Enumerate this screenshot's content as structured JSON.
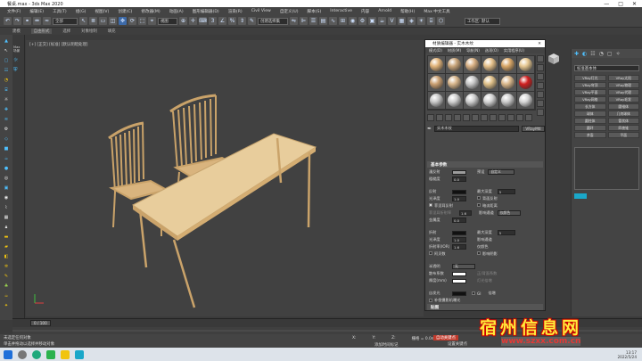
{
  "window": {
    "title": "餐桌.max - 3ds Max 2020",
    "minimize": "—",
    "maximize": "□",
    "close": "✕"
  },
  "menus": [
    "文件(F)",
    "编辑(E)",
    "工具(T)",
    "组(G)",
    "视图(V)",
    "创建(C)",
    "修改器(M)",
    "动画(A)",
    "图形编辑器(D)",
    "渲染(R)",
    "Civil View",
    "自定义(U)",
    "脚本(S)",
    "Interactive",
    "内容",
    "Arnold",
    "帮助(H)",
    "Max 中文工具"
  ],
  "toolbar": {
    "filter": "全部",
    "view": "视图",
    "selection_set": "创建选择集",
    "workspace": "工作区: 默认"
  },
  "ribbon": [
    "建模",
    "自由形式",
    "选择",
    "对象绘制",
    "填充"
  ],
  "ribbon_active": 1,
  "viewport_label": "[+] [正交] [标准] [默认明暗处理]",
  "scene_label": "Max\n场景",
  "right_panel": {
    "dropdown": "标准基本体",
    "buttons": [
      "VRay灯光",
      "VRay太阳",
      "VRay穹顶",
      "VRay物理",
      "VRay平面",
      "VRay代理",
      "VRay网格",
      "VRay毛发",
      "长方体",
      "圆锥体",
      "球体",
      "几何球体",
      "圆柱体",
      "管状体",
      "圆环",
      "四棱锥",
      "茶壶",
      "平面"
    ]
  },
  "mat_editor": {
    "title": "材质编辑器 - 实木木纹",
    "menus": [
      "模式(D)",
      "材质(M)",
      "导航(N)",
      "选项(O)",
      "实用程序(U)"
    ],
    "material_name": "实木木纹",
    "material_type": "VRayMtl",
    "sphere_colors": [
      "#e2b47a",
      "#c9a57a",
      "#d8b084",
      "#e5c08a",
      "#d9a768",
      "#e6c791",
      "#cba072",
      "#d8b68c",
      "#c8c8c8",
      "#e0c18a",
      "#dab88c",
      "#d02020",
      "#c9c9c9",
      "#d0d0d0",
      "#cfcfcf",
      "#d5d5d5",
      "#cccccc",
      "#d6d6d6"
    ],
    "rollouts": {
      "basic": "基本参数",
      "maps": "贴图"
    },
    "params": {
      "diffuse": "漫反射",
      "roughness": "粗糙度",
      "roughness_val": "0.0",
      "preset": "预设",
      "preset_val": "自定义",
      "reflect": "反射",
      "gloss": "光泽度",
      "gloss_val": "1.0",
      "fresnel": "菲涅耳反射",
      "fresnel_ior": "菲涅耳折射率",
      "fresnel_ior_val": "1.6",
      "max_depth": "最大深度",
      "max_depth_val": "5",
      "back_reflect": "背面反射",
      "dim_dist": "暗淡距离",
      "affect_channels": "影响通道",
      "affect_channels_val": "仅颜色",
      "metalness": "金属度",
      "metalness_val": "0.0",
      "refract": "折射",
      "refract_gloss_val": "1.0",
      "ior": "折射率(IOR)",
      "ior_val": "1.6",
      "abbe": "阿贝数",
      "fog_color": "烟雾颜色",
      "fog_mult": "烟雾倍增",
      "affect_shadows": "影响阴影",
      "translucency": "半透明",
      "translucency_val": "无",
      "scatter_coef": "散布系数",
      "thickness": "厚度(mm)",
      "fwd_bck": "正/背面系数",
      "light_mult": "灯光倍增",
      "self_illum": "自发光",
      "gi": "GI",
      "mult": "倍增",
      "compensate": "补偿摄影机曝光"
    }
  },
  "timeline": {
    "frame": "0 / 100"
  },
  "status": {
    "line1": "未选定任何对象",
    "line2": "单击并拖动以选择并移动对象",
    "x": "X:",
    "y": "Y:",
    "z": "Z:",
    "grid": "栅格 = 0.0mm",
    "addtime": "添加时间标记",
    "auto_key": "自动关键点",
    "set_key": "设置关键点",
    "selected": "选定对象",
    "key_filter": "关键点过滤器..."
  },
  "taskbar": {
    "time": "13:17",
    "date": "2022/5/24"
  },
  "watermark": {
    "cn": "宿州信息网",
    "url": "www.szxx.com.cn"
  }
}
